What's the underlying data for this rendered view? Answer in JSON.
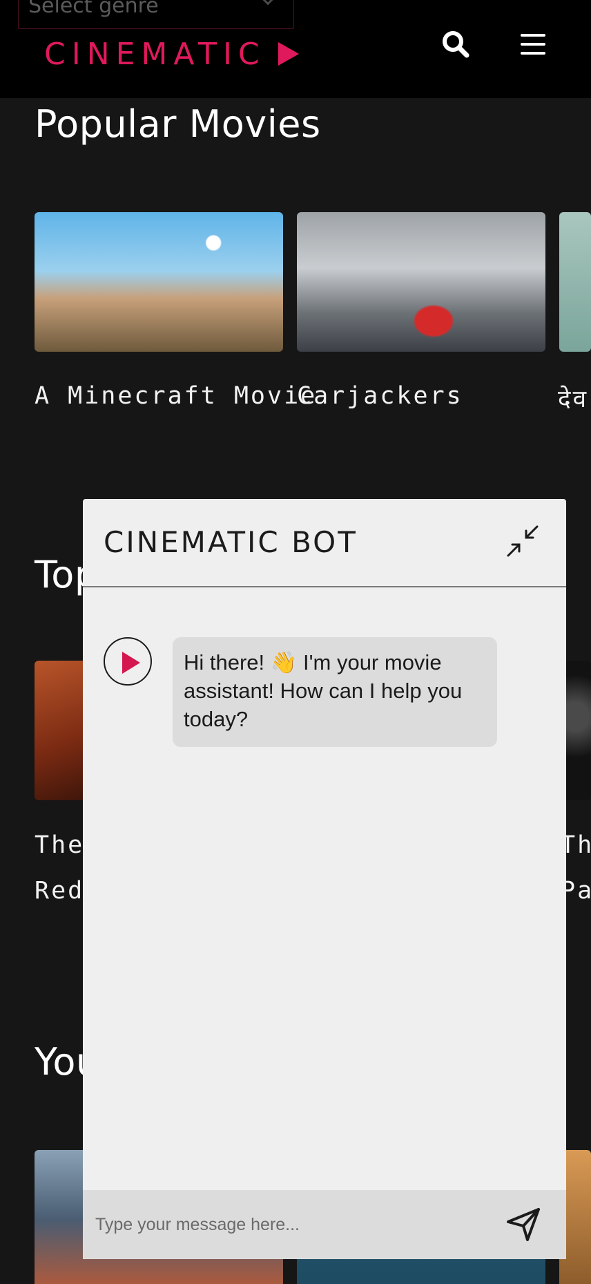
{
  "header": {
    "genre_placeholder": "Select genre",
    "logo_text": "CINEMATIC",
    "search_icon": "search-icon",
    "menu_icon": "menu-icon"
  },
  "sections": [
    {
      "title": "Popular Movies",
      "movies": [
        "A Minecraft Movie",
        "Carjackers",
        "देव"
      ]
    },
    {
      "title": "Top",
      "movies": [
        "The",
        "Red",
        "Th",
        "Pa"
      ]
    },
    {
      "title": "You"
    }
  ],
  "chat": {
    "title": "CINEMATIC BOT",
    "minimize_icon": "minimize-icon",
    "messages": [
      {
        "sender": "bot",
        "text": "Hi there! 👋 I'm your movie assistant! How can I help you today?"
      }
    ],
    "input_placeholder": "Type your message here...",
    "send_icon": "send-icon"
  },
  "colors": {
    "brand": "#e0195d",
    "page_bg": "#161616",
    "header_bg": "#000000",
    "chat_bg": "#efefef",
    "bubble_bg": "#dddcdd"
  }
}
